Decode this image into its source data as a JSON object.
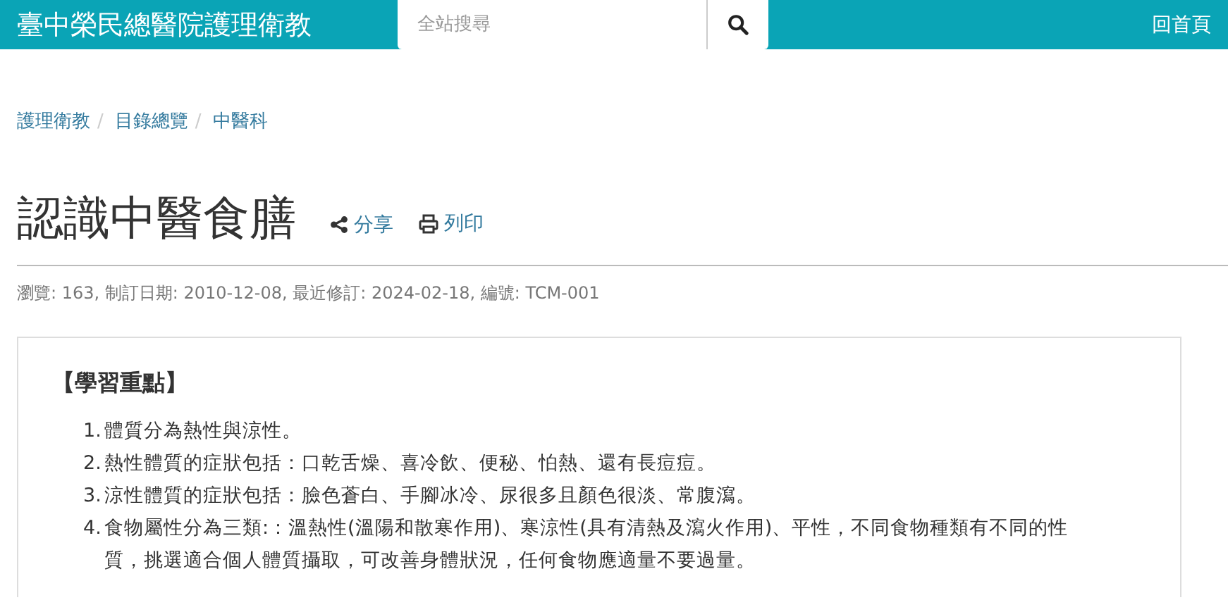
{
  "header": {
    "site_title": "臺中榮民總醫院護理衛教",
    "search": {
      "placeholder": "全站搜尋"
    },
    "home_link": "回首頁"
  },
  "breadcrumb": [
    {
      "label": "護理衛教",
      "separator": "/"
    },
    {
      "label": "目錄總覽",
      "separator": "/"
    },
    {
      "label": "中醫科"
    }
  ],
  "article": {
    "title": "認識中醫食膳",
    "actions": [
      {
        "kind": "share",
        "label": "分享"
      },
      {
        "kind": "print",
        "label": "列印"
      }
    ],
    "meta": "瀏覽: 163, 制訂日期: 2010-12-08, 最近修訂: 2024-02-18, 編號: TCM-001"
  },
  "card": {
    "heading": "【學習重點】",
    "items": [
      {
        "number": "1.",
        "text": "體質分為熱性與涼性。"
      },
      {
        "number": "2.",
        "text": "熱性體質的症狀包括：口乾舌燥、喜冷飲、便秘、怕熱、還有長痘痘。"
      },
      {
        "number": "3.",
        "text": "涼性體質的症狀包括：臉色蒼白、手腳冰冷、尿很多且顏色很淡、常腹瀉。"
      },
      {
        "number": "4.",
        "text": "食物屬性分為三類:：溫熱性(溫陽和散寒作用)、寒涼性(具有清熱及瀉火作用)、平性，不同食物種類有不同的性質，挑選適合個人體質攝取，可改善身體狀況，任何食物應適量不要過量。"
      }
    ]
  }
}
